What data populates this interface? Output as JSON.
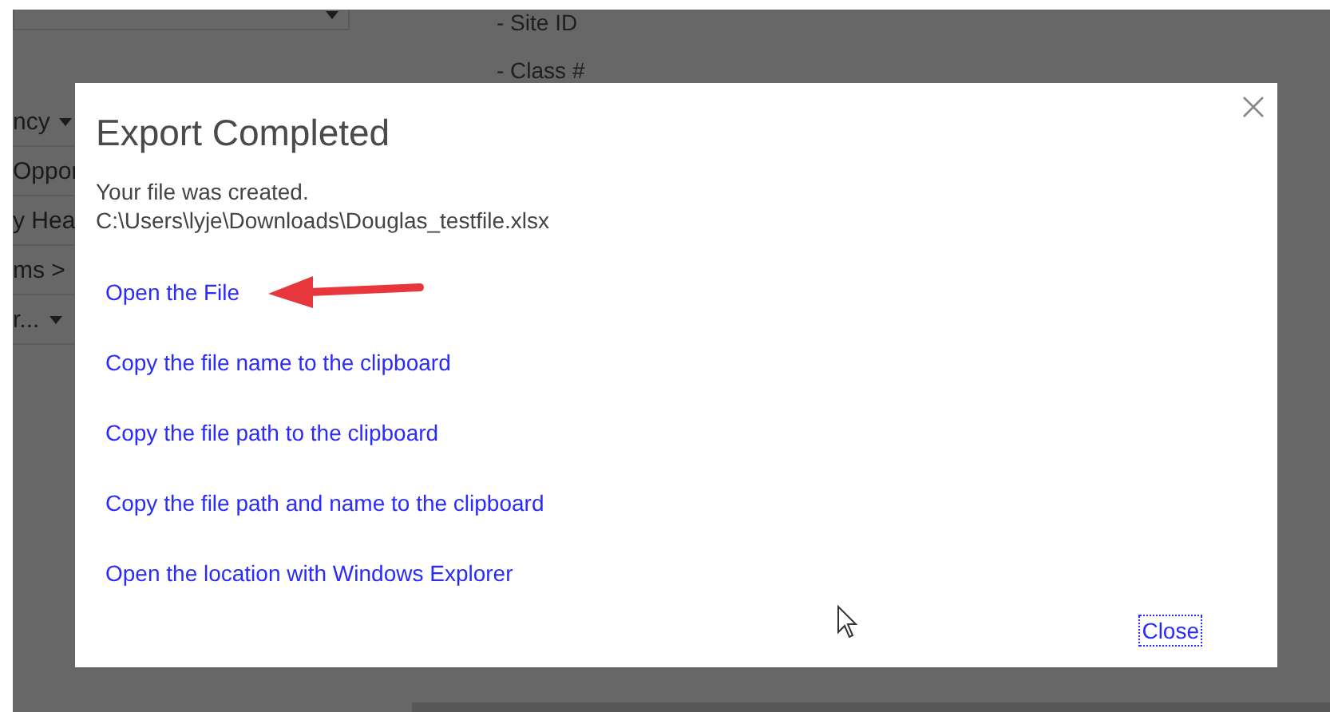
{
  "backdrop": {
    "left_items": [
      {
        "label": "ncy",
        "kind": "dropdown"
      },
      {
        "label": "Oppor",
        "kind": "plain"
      },
      {
        "label": "y Hea",
        "kind": "plain"
      },
      {
        "label": "ms >",
        "kind": "plain"
      },
      {
        "label": "r...",
        "kind": "dropdown"
      }
    ],
    "right_items": [
      "- Site ID",
      "- Class #"
    ]
  },
  "dialog": {
    "title": "Export Completed",
    "message": [
      "Your file was created.",
      "C:\\Users\\lyje\\Downloads\\Douglas_testfile.xlsx"
    ],
    "links": [
      {
        "label": "Open the File",
        "annotated": true
      },
      {
        "label": "Copy the file name to the clipboard",
        "annotated": false
      },
      {
        "label": "Copy the file path to the clipboard",
        "annotated": false
      },
      {
        "label": "Copy the file path and name to the clipboard",
        "annotated": false
      },
      {
        "label": "Open the location with Windows Explorer",
        "annotated": false
      }
    ],
    "close_button": {
      "label": "Close",
      "focused": true
    }
  }
}
